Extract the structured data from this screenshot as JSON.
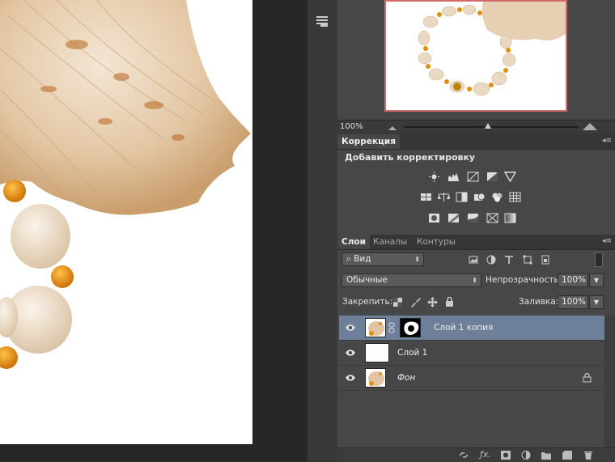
{
  "navigator": {
    "zoom": "100%",
    "zoom_slider_fraction": 0.48
  },
  "correction_panel": {
    "tab": "Коррекция",
    "title": "Добавить корректировку",
    "icons_row1": [
      "brightness-contrast-icon",
      "levels-icon",
      "curves-icon",
      "exposure-icon",
      "vibrance-icon"
    ],
    "icons_row2": [
      "hue-saturation-icon",
      "color-balance-icon",
      "black-white-icon",
      "photo-filter-icon",
      "channel-mixer-icon",
      "color-lookup-icon"
    ],
    "icons_row3": [
      "invert-icon",
      "posterize-icon",
      "threshold-icon",
      "selective-color-icon",
      "gradient-map-icon"
    ]
  },
  "layers_panel": {
    "tabs": [
      "Слои",
      "Каналы",
      "Контуры"
    ],
    "filter_label": "Вид",
    "blend_mode": "Обычные",
    "opacity_label": "Непрозрачность:",
    "opacity_value": "100%",
    "lock_label": "Закрепить:",
    "fill_label": "Заливка:",
    "fill_value": "100%",
    "layers": [
      {
        "name": "Слой 1 копия",
        "selected": true,
        "has_mask": true,
        "italic": false,
        "locked": false
      },
      {
        "name": "Слой 1",
        "selected": false,
        "has_mask": false,
        "italic": false,
        "locked": false
      },
      {
        "name": "Фон",
        "selected": false,
        "has_mask": false,
        "italic": true,
        "locked": true
      }
    ]
  },
  "colors": {
    "panel_bg": "#474747",
    "selected_layer": "#6d7f99",
    "navigator_frame": "#d26b6b"
  }
}
